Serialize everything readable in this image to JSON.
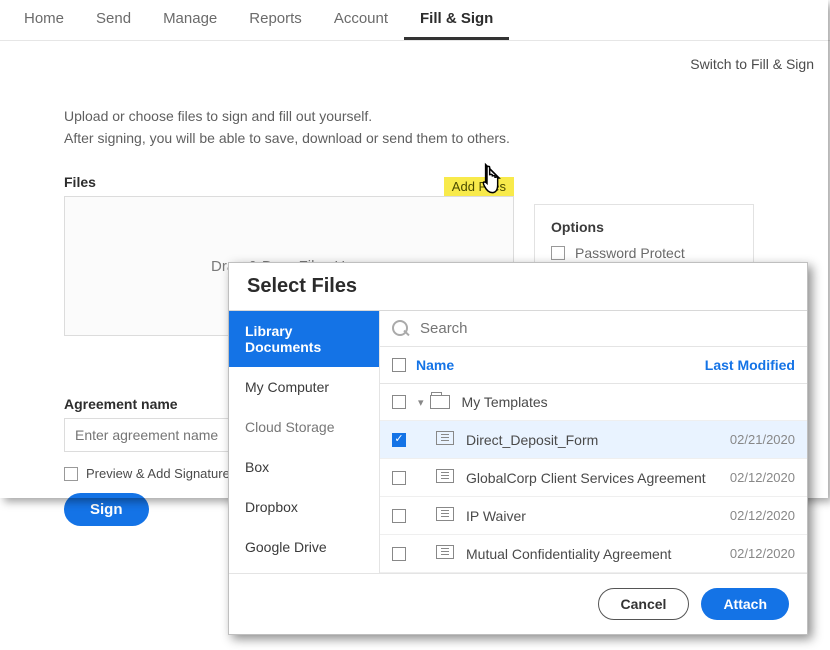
{
  "nav": {
    "tabs": [
      "Home",
      "Send",
      "Manage",
      "Reports",
      "Account",
      "Fill & Sign"
    ],
    "active": 5
  },
  "switch_link": "Switch to Fill & Sign",
  "intro": {
    "l1": "Upload or choose files to sign and fill out yourself.",
    "l2": "After signing, you will be able to save, download or send them to others."
  },
  "files": {
    "label": "Files",
    "add": "Add Files",
    "dropzone": "Drag & Drop Files Here"
  },
  "options": {
    "title": "Options",
    "password": "Password Protect"
  },
  "agreement": {
    "label": "Agreement name",
    "placeholder": "Enter agreement name"
  },
  "preview": "Preview & Add Signature Field",
  "sign": "Sign",
  "dialog": {
    "title": "Select Files",
    "search_placeholder": "Search",
    "side": [
      "Library Documents",
      "My Computer",
      "Cloud Storage",
      "Box",
      "Dropbox",
      "Google Drive"
    ],
    "side_active": 0,
    "headers": {
      "name": "Name",
      "modified": "Last Modified"
    },
    "folder": "My Templates",
    "rows": [
      {
        "name": "Direct_Deposit_Form",
        "modified": "02/21/2020",
        "selected": true
      },
      {
        "name": "GlobalCorp Client Services Agreement",
        "modified": "02/12/2020",
        "selected": false
      },
      {
        "name": "IP Waiver",
        "modified": "02/12/2020",
        "selected": false
      },
      {
        "name": "Mutual Confidentiality Agreement",
        "modified": "02/12/2020",
        "selected": false
      }
    ],
    "cancel": "Cancel",
    "attach": "Attach"
  }
}
